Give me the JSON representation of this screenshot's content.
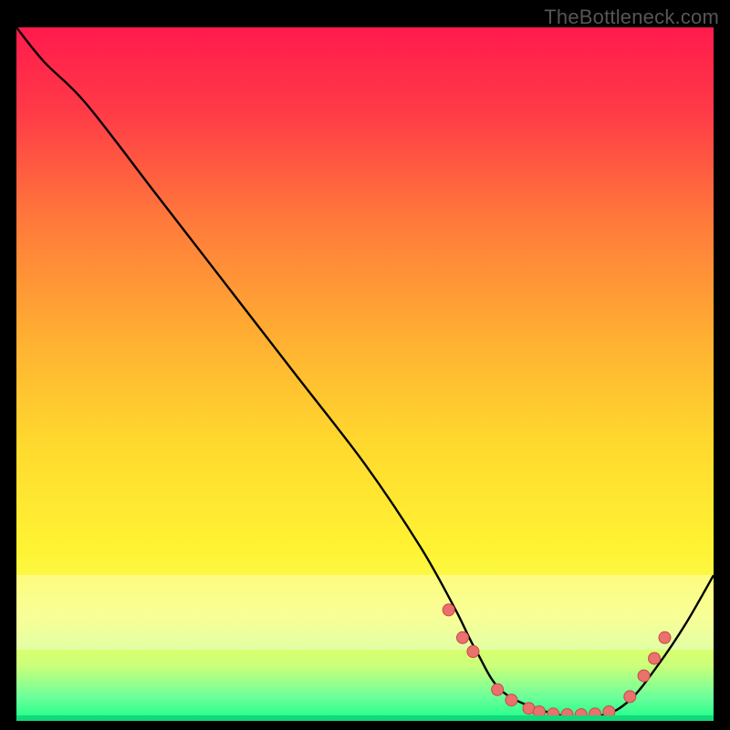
{
  "watermark": "TheBottleneck.com",
  "colors": {
    "curve": "#000000",
    "dot_fill": "#e9716e",
    "dot_stroke": "#c94a47",
    "bottom_line": "#12d97a"
  },
  "chart_data": {
    "type": "line",
    "title": "",
    "xlabel": "",
    "ylabel": "",
    "xlim": [
      0,
      100
    ],
    "ylim": [
      0,
      100
    ],
    "series": [
      {
        "name": "bottleneck-curve",
        "x": [
          0,
          4,
          10,
          20,
          30,
          40,
          50,
          58,
          63,
          66,
          70,
          78,
          84,
          88,
          92,
          96,
          100
        ],
        "y": [
          100,
          95,
          89,
          76,
          63,
          50,
          37,
          25,
          16,
          10,
          4,
          0.8,
          0.8,
          3,
          8,
          14,
          21
        ]
      }
    ],
    "scatter": [
      {
        "name": "marker-dots",
        "x": [
          62,
          64,
          65.5,
          69,
          71,
          73.5,
          75,
          77,
          79,
          81,
          83,
          85,
          88,
          90,
          91.5,
          93
        ],
        "y": [
          16,
          12,
          10,
          4.5,
          3,
          1.8,
          1.3,
          1.0,
          0.9,
          0.9,
          1.0,
          1.3,
          3.5,
          6.5,
          9,
          12
        ]
      }
    ],
    "baseline_y": 0
  }
}
